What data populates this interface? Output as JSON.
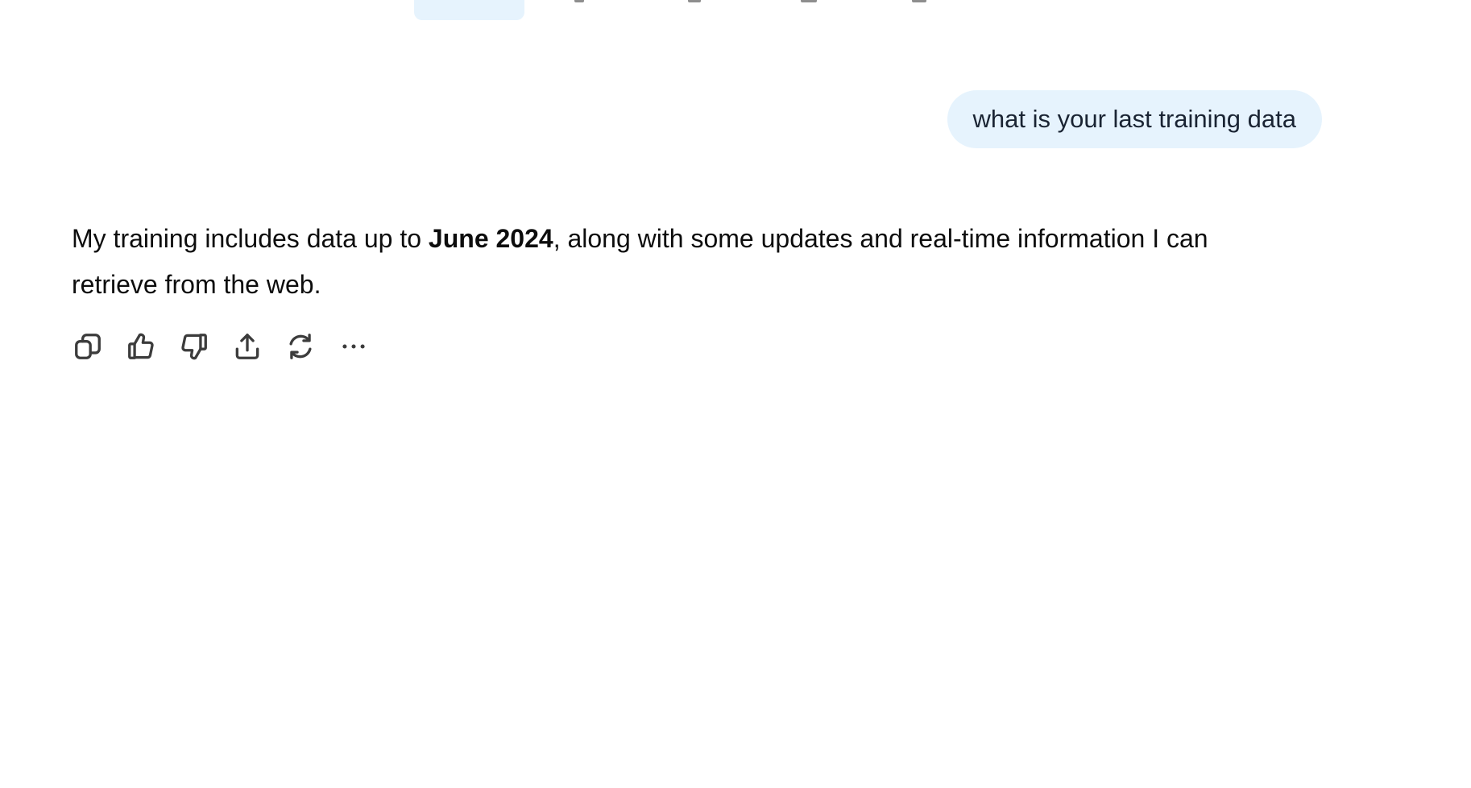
{
  "user_message": {
    "text": "what is your last training data"
  },
  "assistant_message": {
    "text_before": "My training includes data up to ",
    "bold": "June 2024",
    "text_after": ", along with some updates and real-time information I can retrieve from the web."
  },
  "actions": [
    {
      "icon": "copy-icon"
    },
    {
      "icon": "thumbs-up-icon"
    },
    {
      "icon": "thumbs-down-icon"
    },
    {
      "icon": "share-icon"
    },
    {
      "icon": "regenerate-icon"
    },
    {
      "icon": "more-icon"
    }
  ],
  "colors": {
    "bubble_bg": "#e6f3fd",
    "active_tab_bg": "#e6f3fd",
    "icon_stroke": "#3c3c3c",
    "text": "#0d0d0d"
  }
}
